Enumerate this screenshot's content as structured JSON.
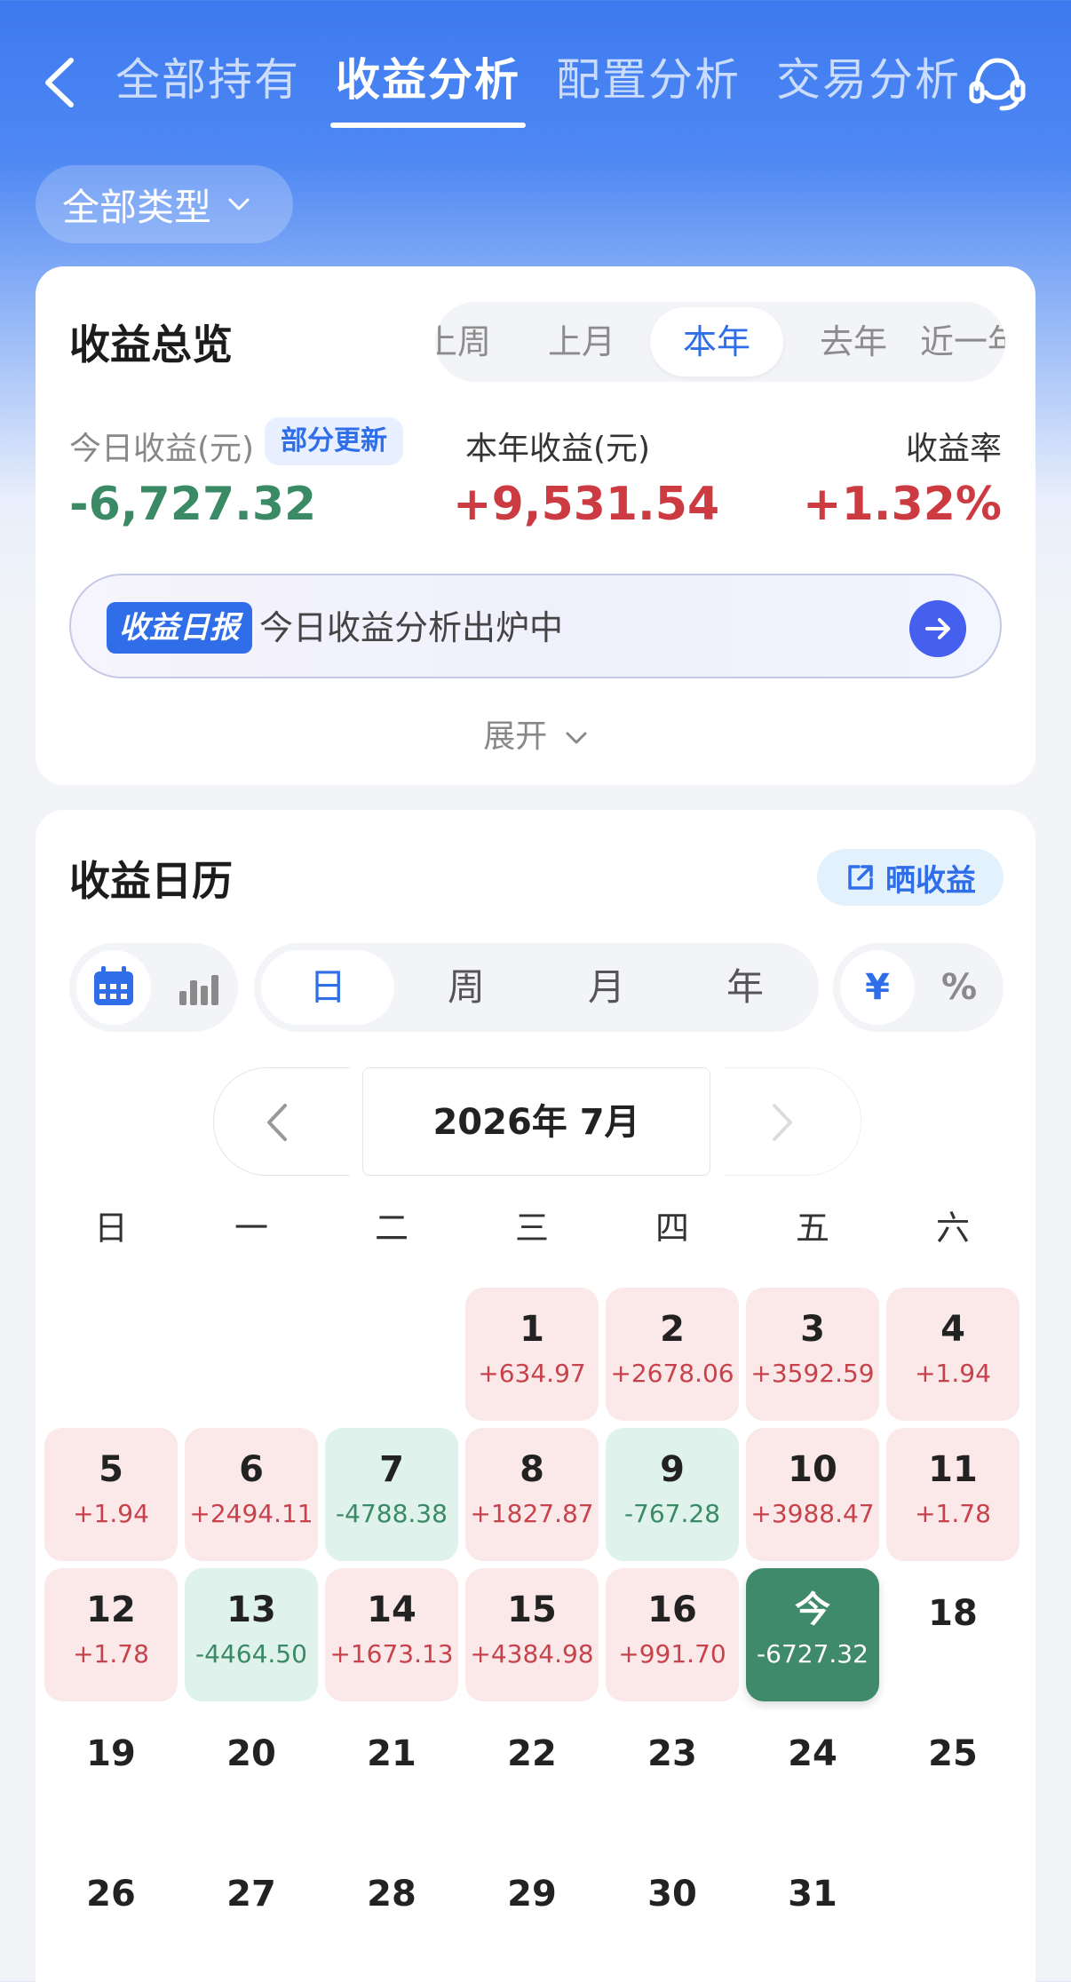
{
  "header": {
    "tabs": [
      {
        "label": "全部持有",
        "active": false
      },
      {
        "label": "收益分析",
        "active": true
      },
      {
        "label": "配置分析",
        "active": false
      },
      {
        "label": "交易分析",
        "active": false
      }
    ]
  },
  "filter": {
    "label": "全部类型"
  },
  "overview": {
    "title": "收益总览",
    "periods": [
      {
        "label": "上周",
        "active": false
      },
      {
        "label": "上月",
        "active": false
      },
      {
        "label": "本年",
        "active": true
      },
      {
        "label": "去年",
        "active": false
      },
      {
        "label": "近一年",
        "active": false
      }
    ],
    "today_label": "今日收益(元)",
    "today_badge": "部分更新",
    "today_value": "-6,727.32",
    "year_label": "本年收益(元)",
    "year_value": "+9,531.54",
    "rate_label": "收益率",
    "rate_value": "+1.32%",
    "report_tag": "收益日报",
    "report_text": "今日收益分析出炉中",
    "expand_label": "展开"
  },
  "calendar": {
    "title": "收益日历",
    "share_label": "晒收益",
    "granularity": [
      {
        "label": "日",
        "active": true
      },
      {
        "label": "周",
        "active": false
      },
      {
        "label": "月",
        "active": false
      },
      {
        "label": "年",
        "active": false
      }
    ],
    "units": [
      {
        "label": "¥",
        "active": true
      },
      {
        "label": "%",
        "active": false
      }
    ],
    "month_label": "2026年 7月",
    "weekdays": [
      "日",
      "一",
      "二",
      "三",
      "四",
      "五",
      "六"
    ],
    "first_weekday": 3,
    "days": [
      {
        "day": "1",
        "value": "+634.97",
        "type": "pos"
      },
      {
        "day": "2",
        "value": "+2678.06",
        "type": "pos"
      },
      {
        "day": "3",
        "value": "+3592.59",
        "type": "pos"
      },
      {
        "day": "4",
        "value": "+1.94",
        "type": "pos"
      },
      {
        "day": "5",
        "value": "+1.94",
        "type": "pos"
      },
      {
        "day": "6",
        "value": "+2494.11",
        "type": "pos"
      },
      {
        "day": "7",
        "value": "-4788.38",
        "type": "neg"
      },
      {
        "day": "8",
        "value": "+1827.87",
        "type": "pos"
      },
      {
        "day": "9",
        "value": "-767.28",
        "type": "neg"
      },
      {
        "day": "10",
        "value": "+3988.47",
        "type": "pos"
      },
      {
        "day": "11",
        "value": "+1.78",
        "type": "pos"
      },
      {
        "day": "12",
        "value": "+1.78",
        "type": "pos"
      },
      {
        "day": "13",
        "value": "-4464.50",
        "type": "neg"
      },
      {
        "day": "14",
        "value": "+1673.13",
        "type": "pos"
      },
      {
        "day": "15",
        "value": "+4384.98",
        "type": "pos"
      },
      {
        "day": "16",
        "value": "+991.70",
        "type": "pos"
      },
      {
        "day": "今",
        "value": "-6727.32",
        "type": "today"
      },
      {
        "day": "18",
        "value": "",
        "type": "plain"
      },
      {
        "day": "19",
        "value": "",
        "type": "plain"
      },
      {
        "day": "20",
        "value": "",
        "type": "plain"
      },
      {
        "day": "21",
        "value": "",
        "type": "plain"
      },
      {
        "day": "22",
        "value": "",
        "type": "plain"
      },
      {
        "day": "23",
        "value": "",
        "type": "plain"
      },
      {
        "day": "24",
        "value": "",
        "type": "plain"
      },
      {
        "day": "25",
        "value": "",
        "type": "plain"
      },
      {
        "day": "26",
        "value": "",
        "type": "plain"
      },
      {
        "day": "27",
        "value": "",
        "type": "plain"
      },
      {
        "day": "28",
        "value": "",
        "type": "plain"
      },
      {
        "day": "29",
        "value": "",
        "type": "plain"
      },
      {
        "day": "30",
        "value": "",
        "type": "plain"
      },
      {
        "day": "31",
        "value": "",
        "type": "plain"
      }
    ]
  }
}
